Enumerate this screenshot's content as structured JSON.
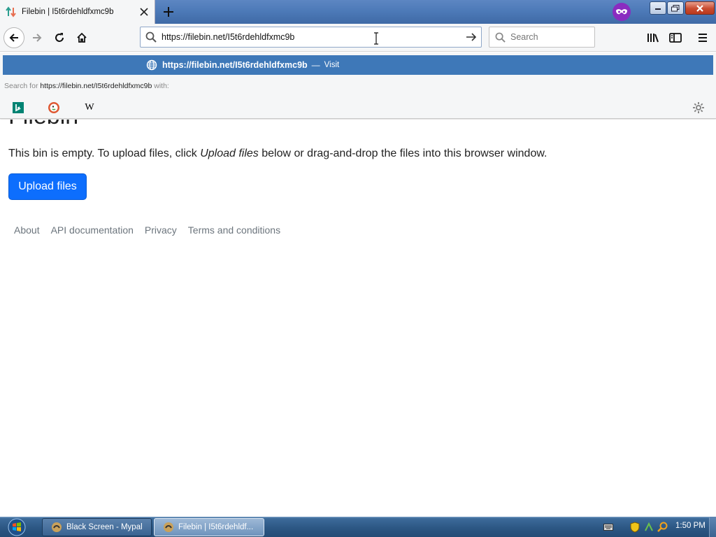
{
  "tab": {
    "title": "Filebin | I5t6rdehldfxmc9b",
    "close_icon": "close-icon"
  },
  "toolbar": {
    "url": "https://filebin.net/I5t6rdehldfxmc9b",
    "search_placeholder": "Search"
  },
  "dropdown": {
    "visit_url": "https://filebin.net/I5t6rdehldfxmc9b",
    "visit_sep": "—",
    "visit_action": "Visit",
    "search_for_prefix": "Search for",
    "search_for_query": "https://filebin.net/I5t6rdehldfxmc9b",
    "search_for_suffix": "with:",
    "engines": [
      "bing",
      "duckduckgo",
      "wikipedia"
    ],
    "wiki_glyph": "W"
  },
  "page": {
    "title": "Filebin",
    "desc_before": "This bin is empty. To upload files, click ",
    "desc_em": "Upload files",
    "desc_after": " below or drag-and-drop the files into this browser window.",
    "upload_label": "Upload files",
    "footer_links": [
      "About",
      "API documentation",
      "Privacy",
      "Terms and conditions"
    ]
  },
  "taskbar": {
    "tasks": [
      "Black Screen - Mypal",
      "Filebin | I5t6rdehldf..."
    ],
    "clock": "1:50 PM"
  },
  "colors": {
    "accent": "#0d6efd",
    "dropdown_highlight": "#3e78b8",
    "private_badge": "#8a2cc0"
  }
}
